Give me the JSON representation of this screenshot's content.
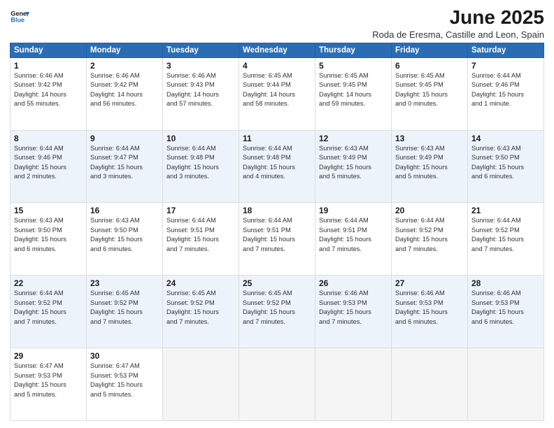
{
  "logo": {
    "line1": "General",
    "line2": "Blue"
  },
  "title": "June 2025",
  "subtitle": "Roda de Eresma, Castille and Leon, Spain",
  "headers": [
    "Sunday",
    "Monday",
    "Tuesday",
    "Wednesday",
    "Thursday",
    "Friday",
    "Saturday"
  ],
  "weeks": [
    [
      {
        "num": "1",
        "info": "Sunrise: 6:46 AM\nSunset: 9:42 PM\nDaylight: 14 hours\nand 55 minutes."
      },
      {
        "num": "2",
        "info": "Sunrise: 6:46 AM\nSunset: 9:42 PM\nDaylight: 14 hours\nand 56 minutes."
      },
      {
        "num": "3",
        "info": "Sunrise: 6:46 AM\nSunset: 9:43 PM\nDaylight: 14 hours\nand 57 minutes."
      },
      {
        "num": "4",
        "info": "Sunrise: 6:45 AM\nSunset: 9:44 PM\nDaylight: 14 hours\nand 58 minutes."
      },
      {
        "num": "5",
        "info": "Sunrise: 6:45 AM\nSunset: 9:45 PM\nDaylight: 14 hours\nand 59 minutes."
      },
      {
        "num": "6",
        "info": "Sunrise: 6:45 AM\nSunset: 9:45 PM\nDaylight: 15 hours\nand 0 minutes."
      },
      {
        "num": "7",
        "info": "Sunrise: 6:44 AM\nSunset: 9:46 PM\nDaylight: 15 hours\nand 1 minute."
      }
    ],
    [
      {
        "num": "8",
        "info": "Sunrise: 6:44 AM\nSunset: 9:46 PM\nDaylight: 15 hours\nand 2 minutes."
      },
      {
        "num": "9",
        "info": "Sunrise: 6:44 AM\nSunset: 9:47 PM\nDaylight: 15 hours\nand 3 minutes."
      },
      {
        "num": "10",
        "info": "Sunrise: 6:44 AM\nSunset: 9:48 PM\nDaylight: 15 hours\nand 3 minutes."
      },
      {
        "num": "11",
        "info": "Sunrise: 6:44 AM\nSunset: 9:48 PM\nDaylight: 15 hours\nand 4 minutes."
      },
      {
        "num": "12",
        "info": "Sunrise: 6:43 AM\nSunset: 9:49 PM\nDaylight: 15 hours\nand 5 minutes."
      },
      {
        "num": "13",
        "info": "Sunrise: 6:43 AM\nSunset: 9:49 PM\nDaylight: 15 hours\nand 5 minutes."
      },
      {
        "num": "14",
        "info": "Sunrise: 6:43 AM\nSunset: 9:50 PM\nDaylight: 15 hours\nand 6 minutes."
      }
    ],
    [
      {
        "num": "15",
        "info": "Sunrise: 6:43 AM\nSunset: 9:50 PM\nDaylight: 15 hours\nand 6 minutes."
      },
      {
        "num": "16",
        "info": "Sunrise: 6:43 AM\nSunset: 9:50 PM\nDaylight: 15 hours\nand 6 minutes."
      },
      {
        "num": "17",
        "info": "Sunrise: 6:44 AM\nSunset: 9:51 PM\nDaylight: 15 hours\nand 7 minutes."
      },
      {
        "num": "18",
        "info": "Sunrise: 6:44 AM\nSunset: 9:51 PM\nDaylight: 15 hours\nand 7 minutes."
      },
      {
        "num": "19",
        "info": "Sunrise: 6:44 AM\nSunset: 9:51 PM\nDaylight: 15 hours\nand 7 minutes."
      },
      {
        "num": "20",
        "info": "Sunrise: 6:44 AM\nSunset: 9:52 PM\nDaylight: 15 hours\nand 7 minutes."
      },
      {
        "num": "21",
        "info": "Sunrise: 6:44 AM\nSunset: 9:52 PM\nDaylight: 15 hours\nand 7 minutes."
      }
    ],
    [
      {
        "num": "22",
        "info": "Sunrise: 6:44 AM\nSunset: 9:52 PM\nDaylight: 15 hours\nand 7 minutes."
      },
      {
        "num": "23",
        "info": "Sunrise: 6:45 AM\nSunset: 9:52 PM\nDaylight: 15 hours\nand 7 minutes."
      },
      {
        "num": "24",
        "info": "Sunrise: 6:45 AM\nSunset: 9:52 PM\nDaylight: 15 hours\nand 7 minutes."
      },
      {
        "num": "25",
        "info": "Sunrise: 6:45 AM\nSunset: 9:52 PM\nDaylight: 15 hours\nand 7 minutes."
      },
      {
        "num": "26",
        "info": "Sunrise: 6:46 AM\nSunset: 9:53 PM\nDaylight: 15 hours\nand 7 minutes."
      },
      {
        "num": "27",
        "info": "Sunrise: 6:46 AM\nSunset: 9:53 PM\nDaylight: 15 hours\nand 6 minutes."
      },
      {
        "num": "28",
        "info": "Sunrise: 6:46 AM\nSunset: 9:53 PM\nDaylight: 15 hours\nand 6 minutes."
      }
    ],
    [
      {
        "num": "29",
        "info": "Sunrise: 6:47 AM\nSunset: 9:53 PM\nDaylight: 15 hours\nand 5 minutes."
      },
      {
        "num": "30",
        "info": "Sunrise: 6:47 AM\nSunset: 9:53 PM\nDaylight: 15 hours\nand 5 minutes."
      },
      {
        "num": "",
        "info": ""
      },
      {
        "num": "",
        "info": ""
      },
      {
        "num": "",
        "info": ""
      },
      {
        "num": "",
        "info": ""
      },
      {
        "num": "",
        "info": ""
      }
    ]
  ]
}
